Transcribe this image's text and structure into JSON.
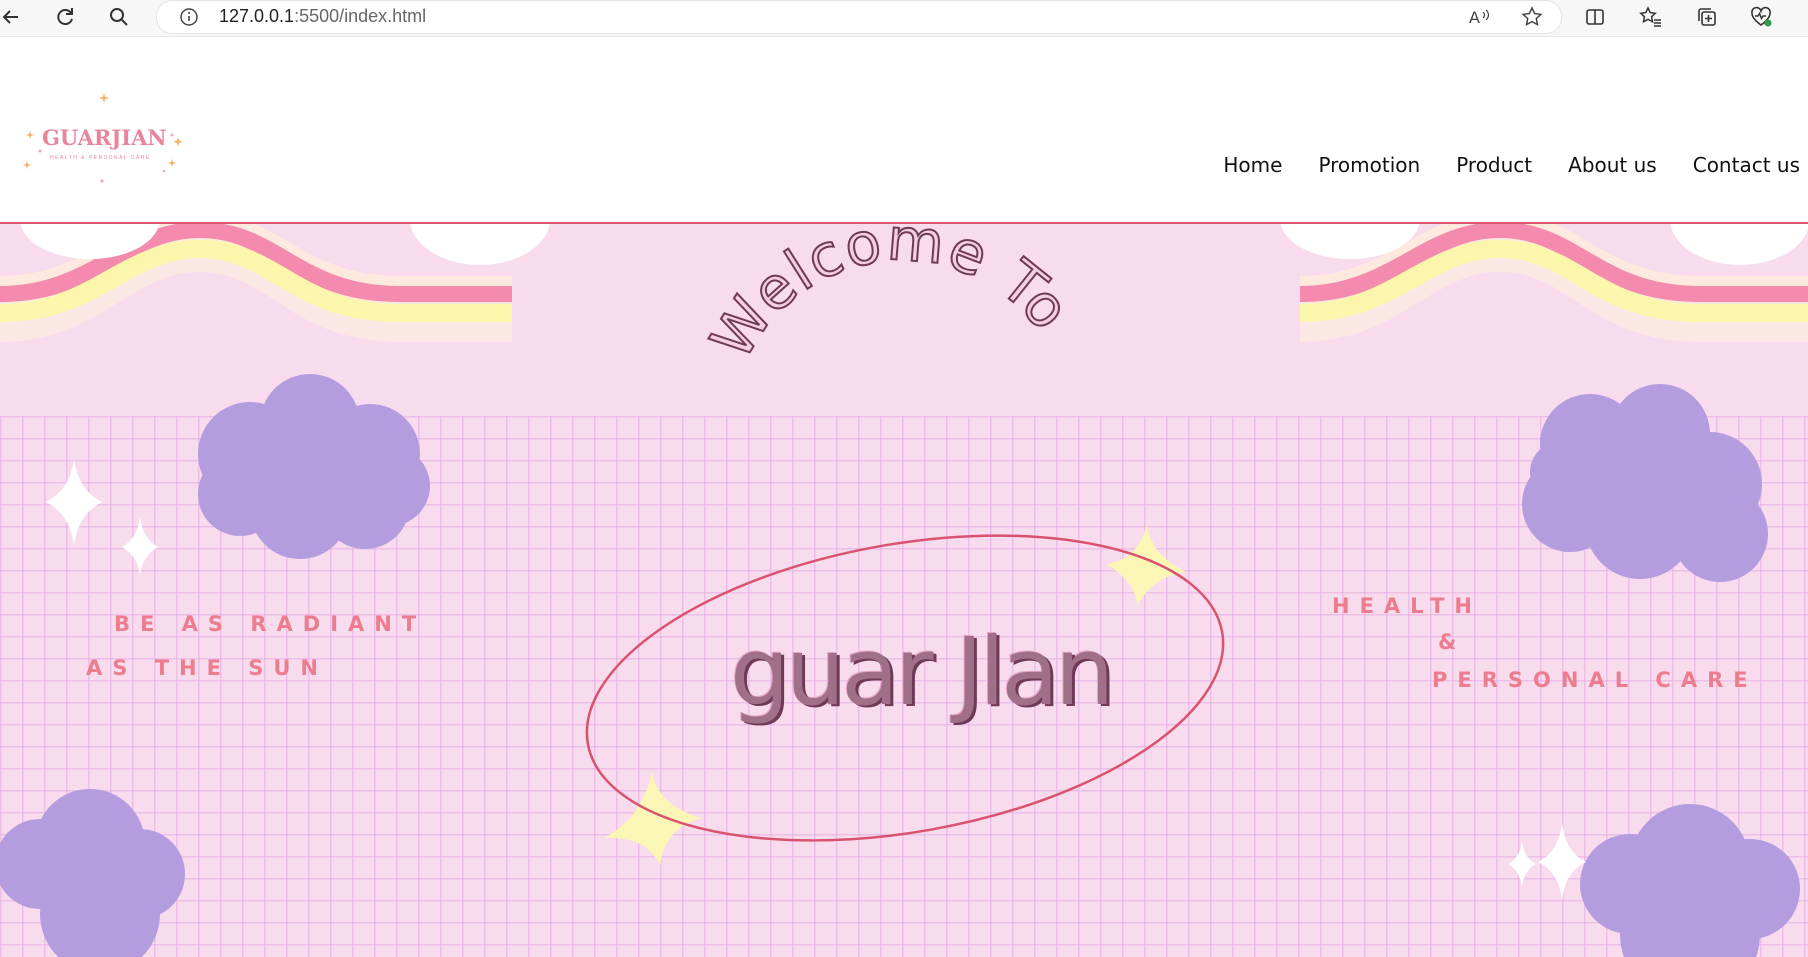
{
  "browser": {
    "url_host": "127.0.0.1",
    "url_path": ":5500/index.html"
  },
  "logo": {
    "text": "GUARJIAN",
    "subtitle": "HEALTH & PERSONAL CARE"
  },
  "nav": {
    "items": [
      "Home",
      "Promotion",
      "Product",
      "About us",
      "Contact us"
    ]
  },
  "hero": {
    "welcome": "Welcome To",
    "brand": "guar Jlan",
    "left_line1": "BE AS RADIANT",
    "left_line2": "AS THE SUN",
    "right_line1": "HEALTH",
    "right_line2": "&",
    "right_line3": "PERSONAL CARE"
  },
  "colors": {
    "hero_bg": "#f8dbed",
    "cloud": "#b39ddf",
    "rainbow_pink": "#f48aae",
    "rainbow_yellow": "#fcf6ad",
    "accent": "#d9536f",
    "sparkle_yellow": "#fcf6b6",
    "tagline": "#ec7d8f"
  }
}
